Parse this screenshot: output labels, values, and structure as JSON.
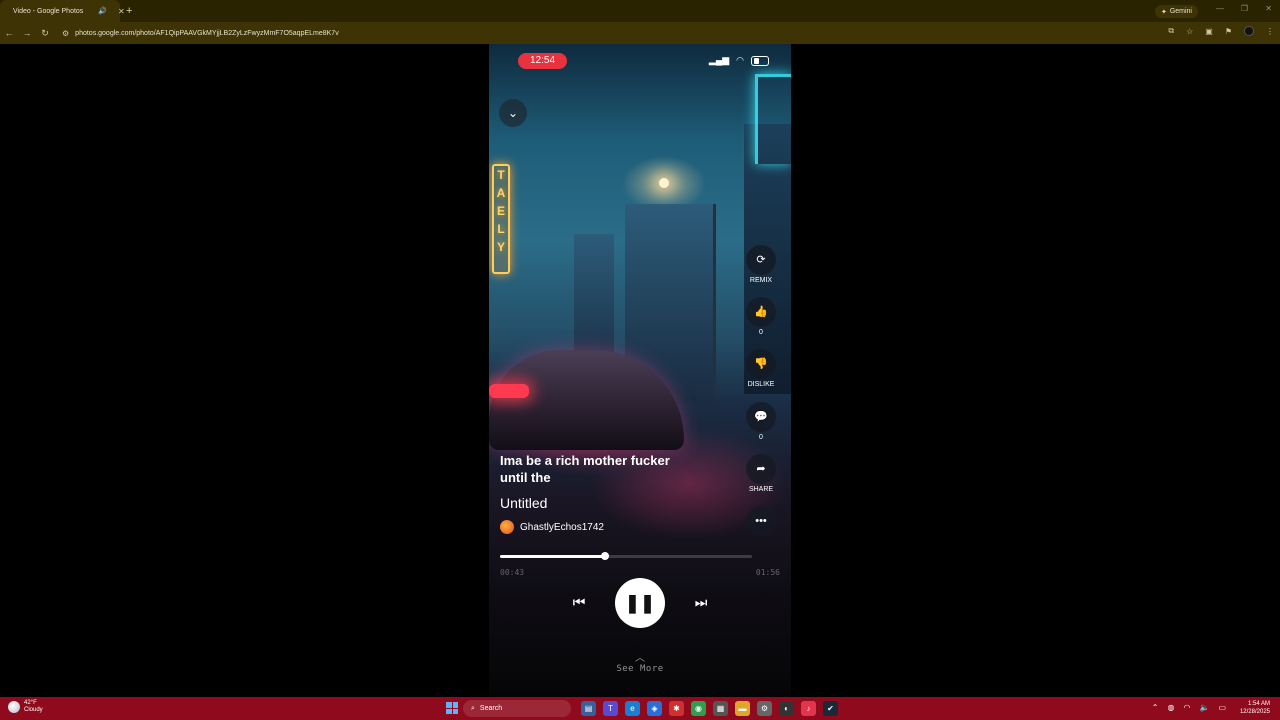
{
  "browser": {
    "tab_title": "Video - Google Photos",
    "tab_audio_icon": "speaker-icon",
    "tab_close": "✕",
    "new_tab": "+",
    "gemini_label": "Gemini",
    "url": "photos.google.com/photo/AF1QipPAAVGkMYjjLB2ZyLzFwyzMmF7O5aqpELme8K7v"
  },
  "player": {
    "status_time": "12:54",
    "lyric": "Ima be a rich mother fucker until the",
    "song_title": "Untitled",
    "artist": "GhastlyEchos1742",
    "time_current": "00:43",
    "time_total": "01:56",
    "progress_fraction": 0.415,
    "see_more": "See More",
    "actions": {
      "remix": "REMIX",
      "like_count": "0",
      "dislike": "DISLIKE",
      "comment_count": "0",
      "share": "SHARE"
    }
  },
  "taskbar": {
    "weather_temp": "42°F",
    "weather_desc": "Cloudy",
    "search_label": "Search",
    "time": "1:54 AM",
    "date": "12/28/2025"
  },
  "colors": {
    "tabbar": "#2a2300",
    "taskbar": "#8e0a1c",
    "status_pill": "#e8323e"
  }
}
